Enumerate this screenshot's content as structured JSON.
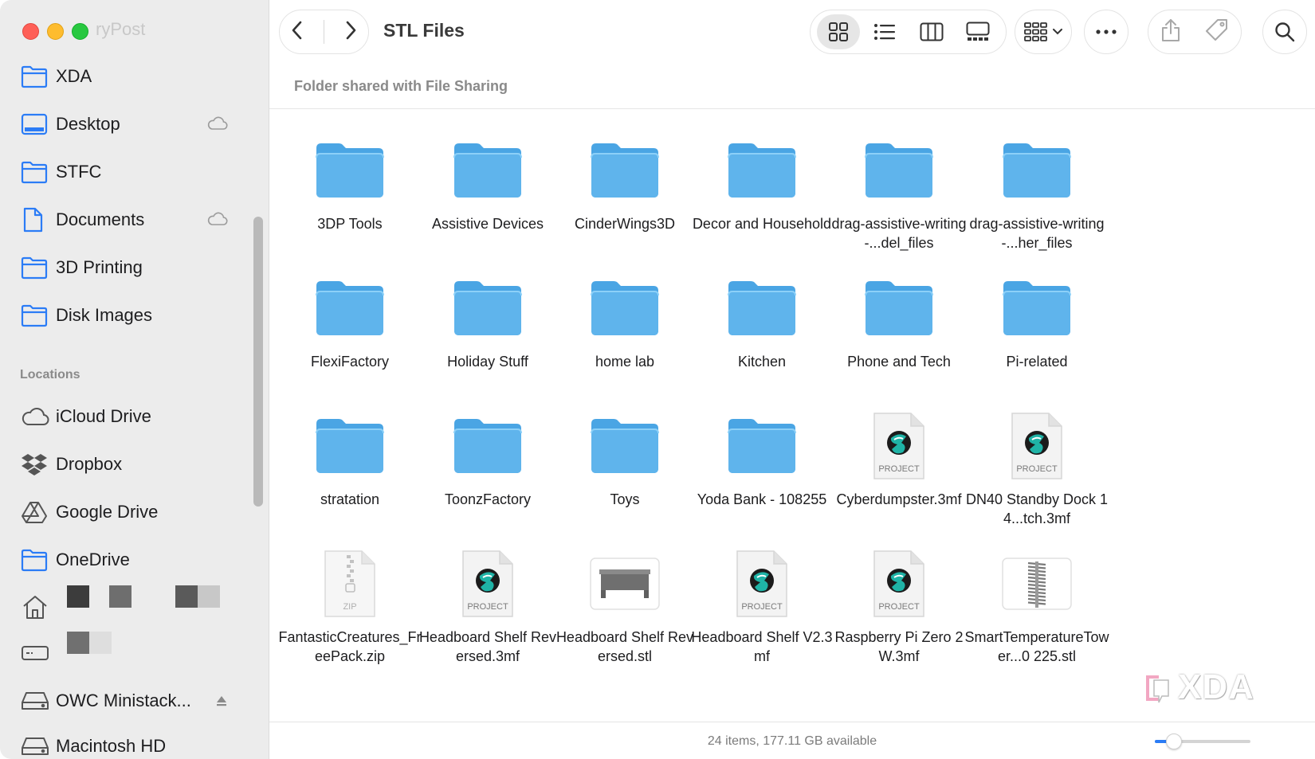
{
  "window": {
    "title": "STL Files",
    "subtitle": "Folder shared with File Sharing"
  },
  "sidebar": {
    "ghost_title": "ryPost",
    "favorites": [
      {
        "label": "XDA",
        "icon": "folder-icon"
      },
      {
        "label": "Desktop",
        "icon": "desktop-icon",
        "cloud": true
      },
      {
        "label": "STFC",
        "icon": "folder-icon"
      },
      {
        "label": "Documents",
        "icon": "document-icon",
        "cloud": true
      },
      {
        "label": "3D Printing",
        "icon": "folder-icon"
      },
      {
        "label": "Disk Images",
        "icon": "folder-icon"
      }
    ],
    "locations_header": "Locations",
    "locations": [
      {
        "label": "iCloud Drive",
        "icon": "icloud-icon"
      },
      {
        "label": "Dropbox",
        "icon": "dropbox-icon"
      },
      {
        "label": "Google Drive",
        "icon": "google-drive-icon"
      },
      {
        "label": "OneDrive",
        "icon": "folder-icon"
      },
      {
        "label": "",
        "icon": "home-icon"
      },
      {
        "label": "",
        "icon": "external-drive-icon"
      },
      {
        "label": "OWC Ministack...",
        "icon": "hard-drive-icon",
        "eject": true
      },
      {
        "label": "Macintosh HD",
        "icon": "hard-drive-icon"
      }
    ]
  },
  "toolbar": {
    "view_modes": [
      "icon-view",
      "list-view",
      "column-view",
      "gallery-view"
    ],
    "group_button": "group-by",
    "more_button": "more-actions",
    "share_button": "share",
    "tag_button": "tags",
    "search_button": "search"
  },
  "items": [
    {
      "name": "3DP Tools",
      "kind": "folder"
    },
    {
      "name": "Assistive Devices",
      "kind": "folder"
    },
    {
      "name": "CinderWings3D",
      "kind": "folder"
    },
    {
      "name": "Decor and Household",
      "kind": "folder"
    },
    {
      "name": "drag-assistive-writing-...del_files",
      "kind": "folder"
    },
    {
      "name": "drag-assistive-writing-...her_files",
      "kind": "folder"
    },
    {
      "name": "FlexiFactory",
      "kind": "folder"
    },
    {
      "name": "Holiday Stuff",
      "kind": "folder"
    },
    {
      "name": "home lab",
      "kind": "folder"
    },
    {
      "name": "Kitchen",
      "kind": "folder"
    },
    {
      "name": "Phone and Tech",
      "kind": "folder"
    },
    {
      "name": "Pi-related",
      "kind": "folder"
    },
    {
      "name": "stratation",
      "kind": "folder"
    },
    {
      "name": "ToonzFactory",
      "kind": "folder"
    },
    {
      "name": "Toys",
      "kind": "folder"
    },
    {
      "name": "Yoda Bank - 108255",
      "kind": "folder"
    },
    {
      "name": "Cyberdumpster.3mf",
      "kind": "project",
      "badge": "PROJECT"
    },
    {
      "name": "DN40 Standby Dock 14...tch.3mf",
      "kind": "project",
      "badge": "PROJECT"
    },
    {
      "name": "FantasticCreatures_FreePack.zip",
      "kind": "zip",
      "badge": "ZIP"
    },
    {
      "name": "Headboard Shelf Reversed.3mf",
      "kind": "project",
      "badge": "PROJECT"
    },
    {
      "name": "Headboard Shelf Reversed.stl",
      "kind": "stl-shelf"
    },
    {
      "name": "Headboard Shelf V2.3mf",
      "kind": "project",
      "badge": "PROJECT"
    },
    {
      "name": "Raspberry Pi Zero 2W.3mf",
      "kind": "project",
      "badge": "PROJECT"
    },
    {
      "name": "SmartTemperatureTower...0 225.stl",
      "kind": "stl-tower"
    }
  ],
  "status": {
    "text": "24 items, 177.11 GB available",
    "icon_size_level": 0.2
  },
  "watermark": "XDA",
  "colors": {
    "folder": "#5fb4ec",
    "accent": "#2b7cf6",
    "sidebar_icon": "#2b7cf6"
  }
}
